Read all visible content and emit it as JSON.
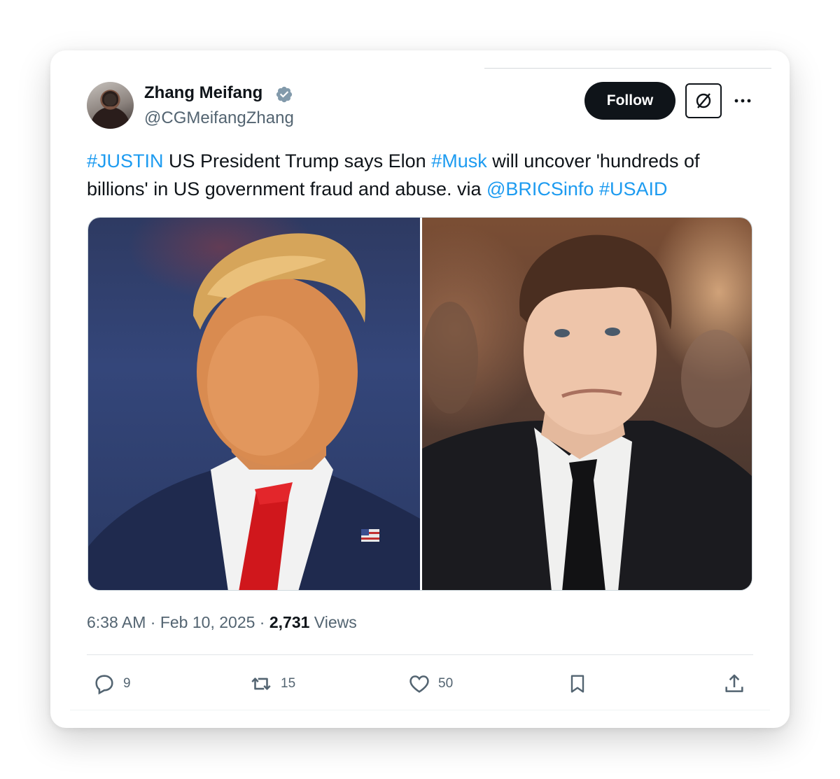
{
  "post": {
    "author": {
      "display_name": "Zhang Meifang",
      "handle": "@CGMeifangZhang",
      "verified_icon": "verified-badge-icon"
    },
    "follow_label": "Follow",
    "text": {
      "tag1": "#JUSTIN",
      "part1": " US President Trump says Elon ",
      "tag2": "#Musk",
      "part2": " will uncover 'hundreds of billions' in US government fraud and abuse. via ",
      "mention": "@BRICSinfo",
      "space": " ",
      "tag3": "#USAID"
    },
    "media": {
      "left": "photo-portrait-suit-red-tie",
      "right": "photo-portrait-suit-black-tie"
    },
    "time": "6:38 AM",
    "sep1": " · ",
    "date": "Feb 10, 2025",
    "sep2": " · ",
    "views_count": "2,731",
    "views_label": " Views",
    "actions": {
      "replies": "9",
      "reposts": "15",
      "likes": "50"
    }
  },
  "colors": {
    "link": "#1d9bf0",
    "text": "#0f1419",
    "muted": "#536471",
    "verified": "#829aab"
  }
}
